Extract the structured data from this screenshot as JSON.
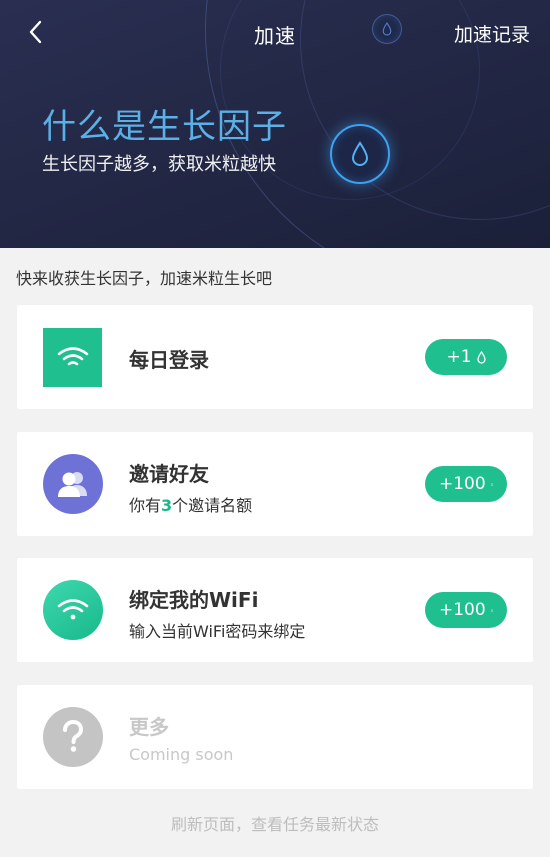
{
  "nav": {
    "title": "加速",
    "record_label": "加速记录"
  },
  "hero": {
    "heading": "什么是生长因子",
    "subheading": "生长因子越多，获取米粒越快"
  },
  "intro": "快来收获生长因子，加速米粒生长吧",
  "tasks": [
    {
      "title": "每日登录",
      "subtitle": "",
      "reward": "+1",
      "icon": "wifi-icon"
    },
    {
      "title": "邀请好友",
      "subtitle_prefix": "你有",
      "subtitle_count": "3",
      "subtitle_suffix": "个邀请名额",
      "reward": "+100",
      "icon": "users-icon"
    },
    {
      "title": "绑定我的WiFi",
      "subtitle": "输入当前WiFi密码来绑定",
      "reward": "+100",
      "icon": "wifi-icon"
    },
    {
      "title": "更多",
      "subtitle": "Coming soon",
      "icon": "question-icon"
    }
  ],
  "footer_tip": "刷新页面，查看任务最新状态",
  "colors": {
    "accent": "#1fbf8f",
    "hero_bg": "#232846",
    "hero_heading": "#5bb0e6",
    "invite_icon_bg": "#6e72d6",
    "disabled": "#c4c4c4"
  }
}
